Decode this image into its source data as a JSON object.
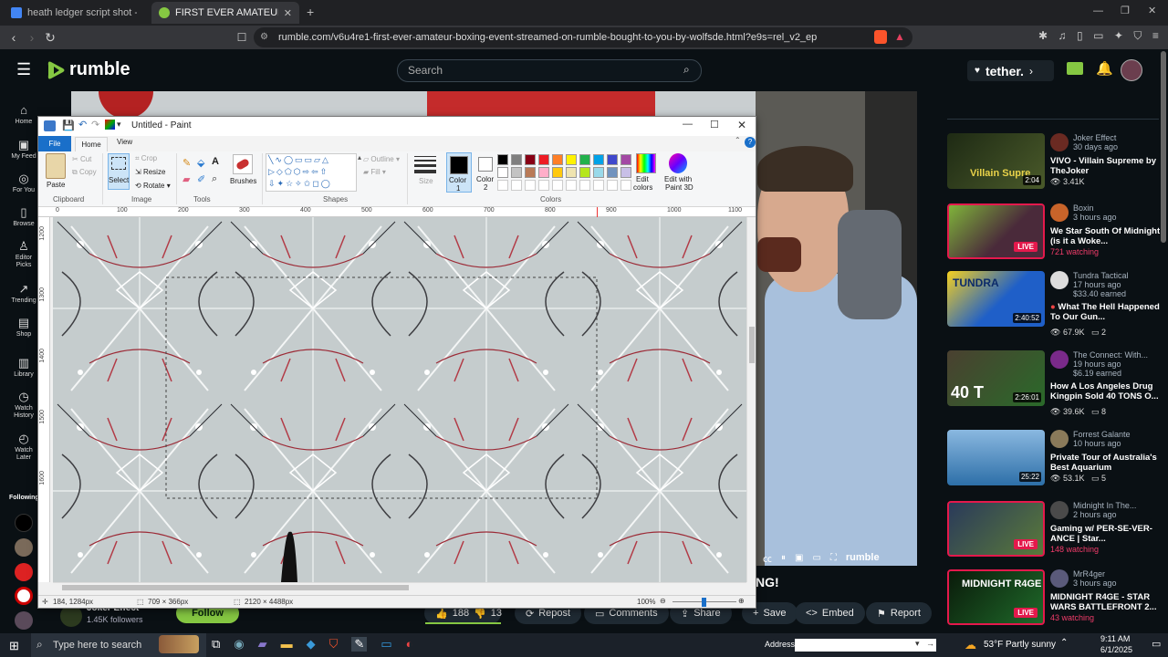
{
  "browser": {
    "tabs": [
      {
        "title": "heath ledger script shot - Google Do",
        "active": false
      },
      {
        "title": "FIRST EVER AMATEUR BOXING E",
        "active": true
      }
    ],
    "new_tab_label": "+",
    "url": "rumble.com/v6u4re1-first-ever-amateur-boxing-event-streamed-on-rumble-bought-to-you-by-wolfsde.html?e9s=rel_v2_ep"
  },
  "rumble": {
    "logo": "rumble",
    "search_placeholder": "Search",
    "tether_label": "tether.",
    "nav": [
      {
        "label": "Home",
        "icon": "home-icon"
      },
      {
        "label": "My Feed",
        "icon": "feed-icon"
      },
      {
        "label": "For You",
        "icon": "for-you-icon"
      },
      {
        "label": "Browse",
        "icon": "browse-icon"
      },
      {
        "label": "Editor Picks",
        "icon": "editor-picks-icon"
      },
      {
        "label": "Trending",
        "icon": "trending-icon"
      },
      {
        "label": "Shop",
        "icon": "shop-icon"
      },
      {
        "label": "Library",
        "icon": "library-icon"
      },
      {
        "label": "Watch History",
        "icon": "watch-history-icon"
      },
      {
        "label": "Watch Later",
        "icon": "watch-later-icon"
      }
    ],
    "following_label": "Following",
    "player": {
      "brand": "rumble",
      "caption_fragment": "NG!"
    },
    "channel": {
      "name": "Joker Effect",
      "followers": "1.45K followers",
      "follow_label": "Follow"
    },
    "actions": {
      "likes": "188",
      "dislikes": "13",
      "repost": "Repost",
      "comments": "Comments",
      "share": "Share",
      "save": "Save",
      "embed": "Embed",
      "report": "Report"
    },
    "sidebar": [
      {
        "channel": "Joker Effect",
        "time": "30 days ago",
        "title": "VIVO - Villain Supreme by TheJoker",
        "meta": "3.41K",
        "duration": "2:04",
        "live": false,
        "thumb_color": "#2b3b1c"
      },
      {
        "channel": "Boxin",
        "time": "3 hours ago",
        "title": "We Star South Of Midnight (is it a Woke...",
        "meta": "721 watching",
        "duration": "",
        "live": true,
        "thumb_color": "#6a2a3a"
      },
      {
        "channel": "Tundra Tactical",
        "time": "17 hours ago",
        "earned": "$33.40 earned",
        "title": "What The Hell Happened To Our Gun...",
        "meta": "67.9K",
        "comments": "2",
        "duration": "2:40:52",
        "live": false,
        "thumb_color": "#1f5fc8"
      },
      {
        "channel": "The Connect: With...",
        "time": "19 hours ago",
        "earned": "$6.19 earned",
        "title": "How A Los Angeles Drug Kingpin Sold 40 TONS O...",
        "meta": "39.6K",
        "comments": "8",
        "duration": "2:26:01",
        "live": false,
        "thumb_color": "#3a3e2a"
      },
      {
        "channel": "Forrest Galante",
        "time": "10 hours ago",
        "title": "Private Tour of Australia's Best Aquarium",
        "meta": "53.1K",
        "comments": "5",
        "duration": "25:22",
        "live": false,
        "thumb_color": "#2d6fa8"
      },
      {
        "channel": "Midnight In The...",
        "time": "2 hours ago",
        "title": "Gaming w/ PER-SE-VER-ANCE | Star...",
        "meta": "148 watching",
        "duration": "",
        "live": true,
        "thumb_color": "#2a3a5a"
      },
      {
        "channel": "MrR4ger",
        "time": "3 hours ago",
        "title": "MIDNIGHT R4GE - STAR WARS BATTLEFRONT 2...",
        "meta": "43 watching",
        "duration": "",
        "live": true,
        "thumb_color": "#0d2a12"
      }
    ]
  },
  "paint": {
    "title": "Untitled - Paint",
    "tabs": [
      "File",
      "Home",
      "View"
    ],
    "clipboard": {
      "paste": "Paste",
      "cut": "Cut",
      "copy": "Copy",
      "label": "Clipboard"
    },
    "image": {
      "select": "Select",
      "crop": "Crop",
      "resize": "Resize",
      "rotate": "Rotate",
      "label": "Image"
    },
    "tools_label": "Tools",
    "brushes": "Brushes",
    "shapes": {
      "outline": "Outline",
      "fill": "Fill",
      "label": "Shapes"
    },
    "size": "Size",
    "color1": "Color\n1",
    "color1_a": "Color",
    "color1_b": "1",
    "color2_a": "Color",
    "color2_b": "2",
    "colors_label": "Colors",
    "edit_colors_a": "Edit",
    "edit_colors_b": "colors",
    "edit3d_a": "Edit with",
    "edit3d_b": "Paint 3D",
    "palette": [
      "#000000",
      "#7f7f7f",
      "#880015",
      "#ed1c24",
      "#ff7f27",
      "#fff200",
      "#22b14c",
      "#00a2e8",
      "#3f48cc",
      "#a349a4",
      "#ffffff",
      "#c3c3c3",
      "#b97a57",
      "#ffaec9",
      "#ffc90e",
      "#efe4b0",
      "#b5e61d",
      "#99d9ea",
      "#7092be",
      "#c8bfe7"
    ],
    "ruler_h": [
      "0",
      "100",
      "200",
      "300",
      "400",
      "500",
      "600",
      "700",
      "800",
      "900",
      "1000",
      "1100"
    ],
    "ruler_v": [
      "1200",
      "1300",
      "1400",
      "1500",
      "1600"
    ],
    "status": {
      "cursor": "184, 1284px",
      "selection": "709 × 366px",
      "size": "2120 × 4488px",
      "zoom": "100%"
    }
  },
  "taskbar": {
    "search_placeholder": "Type here to search",
    "address_label": "Address",
    "weather": "53°F  Partly sunny",
    "time": "9:11 AM",
    "date": "6/1/2025"
  }
}
